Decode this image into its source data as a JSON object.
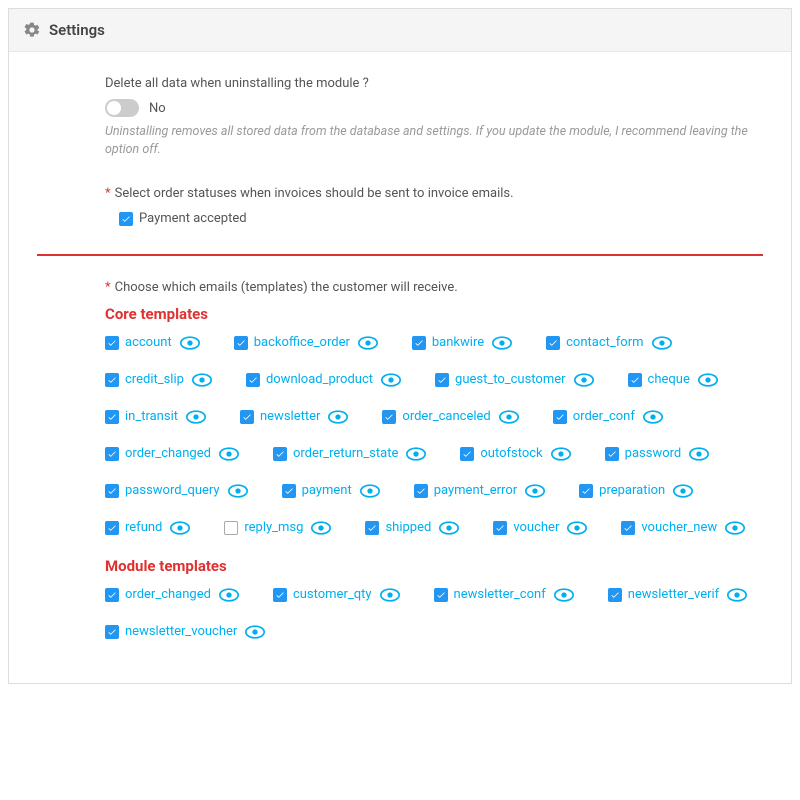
{
  "header": {
    "title": "Settings"
  },
  "delete_data": {
    "question": "Delete all data when uninstalling the module ?",
    "toggle_state": "No",
    "helper": "Uninstalling removes all stored data from the database and settings. If you update the module, I recommend leaving the option off."
  },
  "order_status": {
    "label": "Select order statuses when invoices should be sent to invoice emails.",
    "item0_label": "Payment accepted"
  },
  "emails": {
    "label": "Choose which emails (templates) the customer will receive.",
    "core_title": "Core templates",
    "module_title": "Module templates",
    "core": [
      {
        "name": "account",
        "checked": true
      },
      {
        "name": "backoffice_order",
        "checked": true
      },
      {
        "name": "bankwire",
        "checked": true
      },
      {
        "name": "contact_form",
        "checked": true
      },
      {
        "name": "credit_slip",
        "checked": true
      },
      {
        "name": "download_product",
        "checked": true
      },
      {
        "name": "guest_to_customer",
        "checked": true
      },
      {
        "name": "cheque",
        "checked": true
      },
      {
        "name": "in_transit",
        "checked": true
      },
      {
        "name": "newsletter",
        "checked": true
      },
      {
        "name": "order_canceled",
        "checked": true
      },
      {
        "name": "order_conf",
        "checked": true
      },
      {
        "name": "order_changed",
        "checked": true
      },
      {
        "name": "order_return_state",
        "checked": true
      },
      {
        "name": "outofstock",
        "checked": true
      },
      {
        "name": "password",
        "checked": true
      },
      {
        "name": "password_query",
        "checked": true
      },
      {
        "name": "payment",
        "checked": true
      },
      {
        "name": "payment_error",
        "checked": true
      },
      {
        "name": "preparation",
        "checked": true
      },
      {
        "name": "refund",
        "checked": true
      },
      {
        "name": "reply_msg",
        "checked": false
      },
      {
        "name": "shipped",
        "checked": true
      },
      {
        "name": "voucher",
        "checked": true
      },
      {
        "name": "voucher_new",
        "checked": true
      }
    ],
    "module": [
      {
        "name": "order_changed",
        "checked": true
      },
      {
        "name": "customer_qty",
        "checked": true
      },
      {
        "name": "newsletter_conf",
        "checked": true
      },
      {
        "name": "newsletter_verif",
        "checked": true
      },
      {
        "name": "newsletter_voucher",
        "checked": true
      }
    ]
  }
}
